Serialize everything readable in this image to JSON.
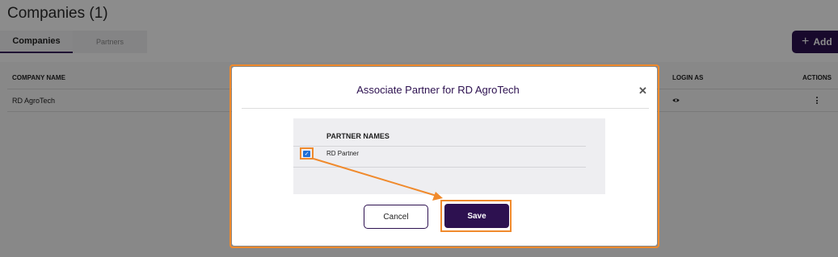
{
  "page": {
    "title": "Companies (1)",
    "tabs": [
      {
        "label": "Companies",
        "active": true
      },
      {
        "label": "Partners",
        "active": false
      }
    ],
    "add_button_label": "Add",
    "add_button_icon": "plus-icon"
  },
  "table": {
    "columns": [
      "COMPANY NAME",
      "LOGIN AS",
      "ACTIONS"
    ],
    "rows": [
      {
        "company_name": "RD AgroTech",
        "login_as_icon": "eye-icon",
        "actions_icon": "kebab-icon"
      }
    ]
  },
  "modal": {
    "title": "Associate Partner for RD AgroTech",
    "close_icon": "close-icon",
    "partner_column": "PARTNER NAMES",
    "partners": [
      {
        "name": "RD Partner",
        "checked": true
      }
    ],
    "cancel_label": "Cancel",
    "save_label": "Save"
  },
  "colors": {
    "brand": "#2d1150",
    "highlight": "#f08a2c",
    "checkbox": "#1f6fd6"
  }
}
